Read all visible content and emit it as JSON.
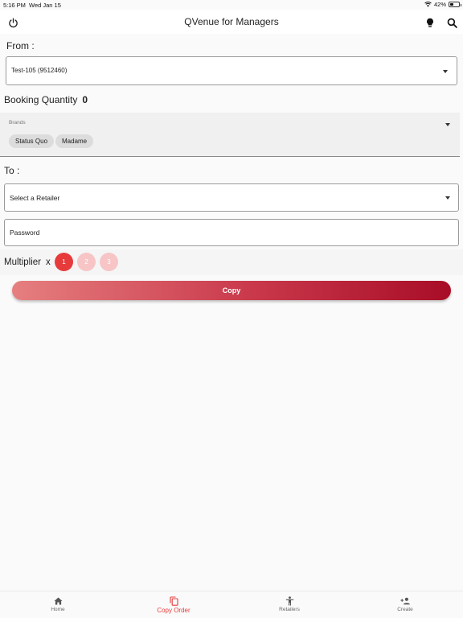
{
  "status": {
    "time": "5:16 PM",
    "date": "Wed Jan 15",
    "battery": "42%",
    "battery_level": 0.42
  },
  "appbar": {
    "title": "QVenue for Managers",
    "left_icon": "power-icon",
    "right_icons": [
      "lightbulb-icon",
      "search-icon"
    ]
  },
  "from": {
    "label": "From :",
    "selected": "Test-105 (9512460)"
  },
  "booking": {
    "label": "Booking Quantity",
    "value": "0"
  },
  "brands": {
    "label": "Brands",
    "chips": [
      "Status Quo",
      "Madame"
    ]
  },
  "to": {
    "label": "To :",
    "retailer_placeholder": "Select a Retailer"
  },
  "password": {
    "placeholder": "Password"
  },
  "multiplier": {
    "label": "Multiplier",
    "x": "x",
    "options": [
      "1",
      "2",
      "3"
    ],
    "selected": "1"
  },
  "copy_button": {
    "label": "Copy"
  },
  "bottom_nav": {
    "active": "Copy Order",
    "items": [
      {
        "label": "Home",
        "icon": "home-icon"
      },
      {
        "label": "Copy Order",
        "icon": "copy-icon"
      },
      {
        "label": "Retailers",
        "icon": "person-icon"
      },
      {
        "label": "Create",
        "icon": "add-person-icon"
      }
    ]
  },
  "colors": {
    "accent": "#e73b3b",
    "accent_light": "#f7c5c6",
    "button_start": "#e67f7f",
    "button_end": "#a80d27"
  }
}
